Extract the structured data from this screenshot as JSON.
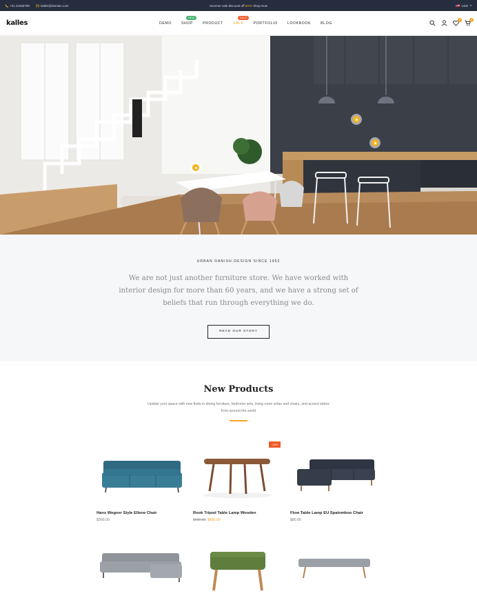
{
  "topbar": {
    "phone": "+01 23456789",
    "email": "kalles@domain.com",
    "promo_prefix": "Summer sale discount off",
    "promo_code": "50%!",
    "promo_link": "Shop Now",
    "currency": "USD"
  },
  "header": {
    "logo": "kalles",
    "nav": [
      {
        "label": "DEMO"
      },
      {
        "label": "SHOP",
        "badge": "NEW"
      },
      {
        "label": "PRODUCT"
      },
      {
        "label": "SALE",
        "badge": "SALE"
      },
      {
        "label": "PORTFOLIO"
      },
      {
        "label": "LOOKBOOK"
      },
      {
        "label": "BLOG"
      }
    ],
    "wishlist_count": "0",
    "cart_count": "0"
  },
  "about": {
    "eyebrow": "URBAN DANISH DESIGN SINCE 1952",
    "text": "We are not just another furniture store. We have worked with interior design for more than 60 years, and we have a strong set of beliefs that run through everything we do.",
    "button": "READ OUR STORY"
  },
  "new_products": {
    "title": "New Products",
    "subtitle": "Update your space with new finds in dining furniture, bedroom sets, living room sofas and chairs, and accent tables from around the world",
    "items": [
      {
        "name": "Hans Wegner Style Elbow Chair",
        "price": "$300.00"
      },
      {
        "name": "Rook Tripod Table Lamp Wooden",
        "old_price": "$680.00",
        "price": "$600.00",
        "badge": "-12%"
      },
      {
        "name": "Flow Table Lamp EU Spainmboo Chair",
        "price": "$80.00"
      }
    ]
  },
  "colors": {
    "accent": "#f6a623",
    "topbar": "#252d3f",
    "badge_new": "#3fb26b",
    "badge_sale": "#f05b2a"
  }
}
